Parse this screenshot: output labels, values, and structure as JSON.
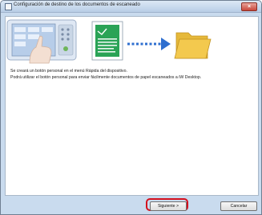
{
  "window": {
    "title": "Configuración de destino de los documentos de escaneado",
    "close_label": "×"
  },
  "messages": {
    "line1": "Se creará un botón personal en el menú Rápida del dispositivo.",
    "line2": "Podrá utilizar el botón personal para enviar fácilmente documentos de papel escaneados a iW Desktop."
  },
  "buttons": {
    "next_label": "Siguiente >",
    "cancel_label": "Cancelar"
  },
  "colors": {
    "highlight": "#d4101e",
    "folder": "#f3c94e",
    "arrow": "#2f6fcf",
    "document": "#2aa356"
  }
}
